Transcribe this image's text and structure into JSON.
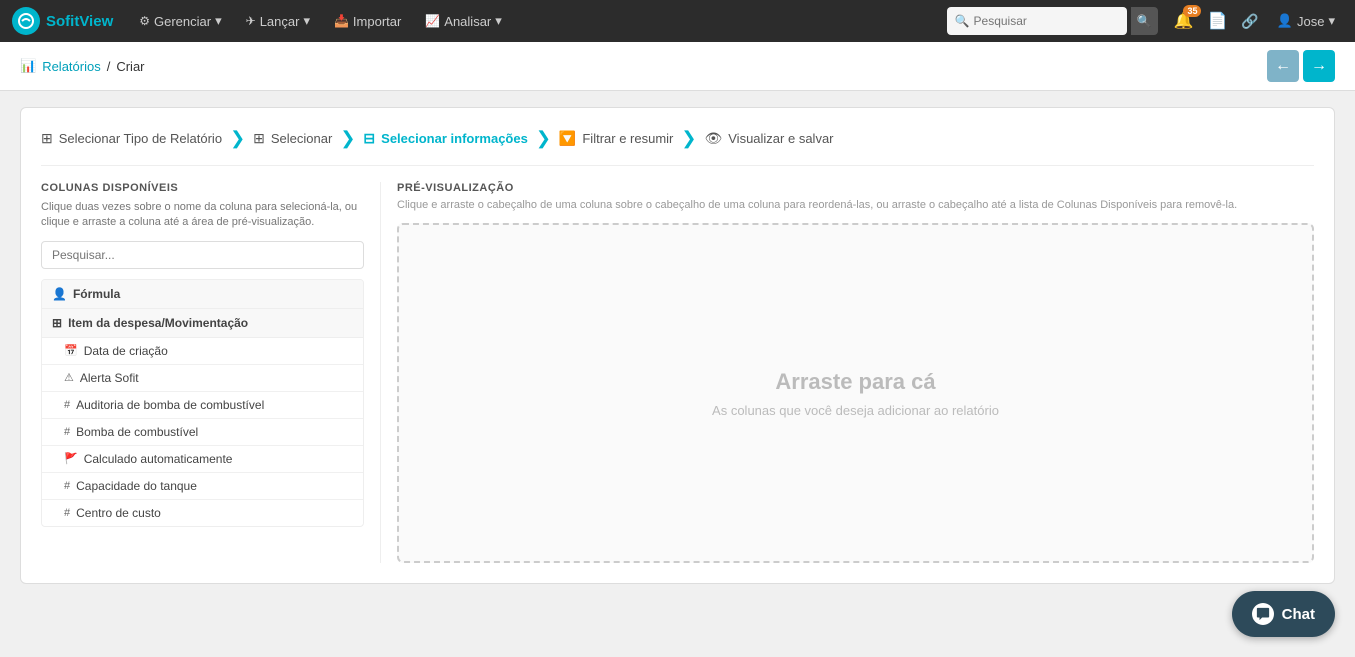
{
  "app": {
    "logo_letter": "S",
    "logo_name_part1": "Sofit",
    "logo_name_part2": "View"
  },
  "topnav": {
    "items": [
      {
        "id": "gerenciar",
        "label": "Gerenciar",
        "icon": "⚙",
        "hasArrow": true
      },
      {
        "id": "lancar",
        "label": "Lançar",
        "icon": "✈",
        "hasArrow": true
      },
      {
        "id": "importar",
        "label": "Importar",
        "icon": "📥",
        "hasArrow": false
      },
      {
        "id": "analisar",
        "label": "Analisar",
        "icon": "📈",
        "hasArrow": true
      }
    ],
    "search_placeholder": "Pesquisar",
    "notifications_count": "35",
    "user_name": "Jose"
  },
  "breadcrumb": {
    "link_label": "Relatórios",
    "separator": "/",
    "current": "Criar"
  },
  "wizard": {
    "steps": [
      {
        "id": "step1",
        "icon": "⊞",
        "label": "Selecionar Tipo de Relatório"
      },
      {
        "id": "step2",
        "icon": "⊞",
        "label": "Selecionar"
      },
      {
        "id": "step3",
        "icon": "⊟",
        "label": "Selecionar informações",
        "active": true
      },
      {
        "id": "step4",
        "icon": "🔽",
        "label": "Filtrar e resumir"
      },
      {
        "id": "step5",
        "icon": "👁",
        "label": "Visualizar e salvar"
      }
    ]
  },
  "left_panel": {
    "title": "COLUNAS DISPONÍVEIS",
    "description": "Clique duas vezes sobre o nome da coluna para selecioná-la, ou clique e arraste a coluna até a área de pré-visualização.",
    "search_placeholder": "Pesquisar...",
    "groups": [
      {
        "id": "formula",
        "icon": "👤",
        "label": "Fórmula",
        "items": []
      },
      {
        "id": "item_despesa",
        "icon": "⊞",
        "label": "Item da despesa/Movimentação",
        "items": [
          {
            "id": "data_criacao",
            "icon": "📅",
            "label": "Data de criação"
          },
          {
            "id": "alerta_sofit",
            "icon": "⚠",
            "label": "Alerta Sofit"
          },
          {
            "id": "auditoria_bomba",
            "icon": "#",
            "label": "Auditoria de bomba de combustível"
          },
          {
            "id": "bomba_combustivel",
            "icon": "#",
            "label": "Bomba de combustível"
          },
          {
            "id": "calculado_auto",
            "icon": "🚩",
            "label": "Calculado automaticamente"
          },
          {
            "id": "capacidade_tanque",
            "icon": "#",
            "label": "Capacidade do tanque"
          },
          {
            "id": "centro_custo",
            "icon": "#",
            "label": "Centro de custo"
          }
        ]
      }
    ]
  },
  "right_panel": {
    "title": "PRÉ-VISUALIZAÇÃO",
    "description": "Clique e arraste o cabeçalho de uma coluna sobre o cabeçalho de uma coluna para reordená-las, ou arraste o cabeçalho até a lista de Colunas Disponíveis para removê-la.",
    "drop_main_text": "Arraste para cá",
    "drop_sub_text": "As colunas que você deseja adicionar ao relatório"
  },
  "chat": {
    "label": "Chat"
  }
}
